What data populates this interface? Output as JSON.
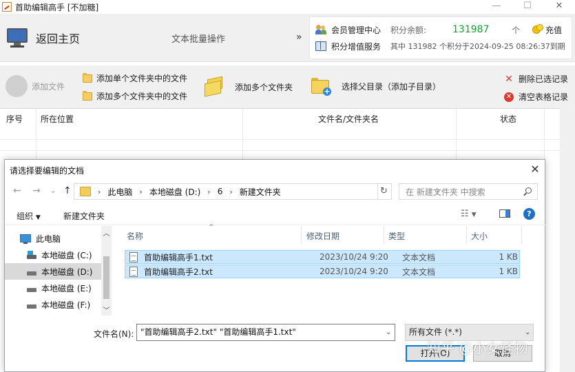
{
  "window": {
    "title": "首助编辑高手 [不加糖]",
    "minimize": "—",
    "maximize": "☐",
    "close": "✕"
  },
  "header": {
    "home_label": "返回主页",
    "batch_label": "文本批量操作",
    "arrow": "»",
    "member_center": "会员管理中心",
    "points_balance_label": "积分余额:",
    "points_balance": "131987",
    "points_unit": "个",
    "recharge": "充值",
    "points_service": "积分增值服务",
    "points_detail": "其中 131982 个积分于2024-09-25 08:26:37到期"
  },
  "toolbar": {
    "add_file": "添加文件",
    "add_single_folder": "添加单个文件夹中的文件",
    "add_multi_folder": "添加多个文件夹中的文件",
    "add_folders": "添加多个文件夹",
    "select_parent": "选择父目录（添加子目录）",
    "delete_selected": "删除已选记录",
    "clear_table": "清空表格记录"
  },
  "table": {
    "columns": [
      "序号",
      "所在位置",
      "文件名/文件夹名",
      "状态"
    ]
  },
  "dialog": {
    "title": "请选择要编辑的文档",
    "close": "✕",
    "breadcrumb": [
      "此电脑",
      "本地磁盘 (D:)",
      "6",
      "新建文件夹"
    ],
    "search_placeholder": "在 新建文件夹 中搜索",
    "organize": "组织",
    "new_folder": "新建文件夹",
    "help": "?",
    "nav_items": [
      {
        "label": "此电脑",
        "icon": "computer-icon"
      },
      {
        "label": "本地磁盘 (C:)",
        "icon": "drive-icon"
      },
      {
        "label": "本地磁盘 (D:)",
        "icon": "drive-icon"
      },
      {
        "label": "本地磁盘 (E:)",
        "icon": "drive-icon"
      },
      {
        "label": "本地磁盘 (F:)",
        "icon": "drive-icon"
      }
    ],
    "file_headers": [
      "名称",
      "修改日期",
      "类型",
      "大小"
    ],
    "files": [
      {
        "name": "首助编辑高手1.txt",
        "date": "2023/10/24 9:20",
        "type": "文本文档",
        "size": "1 KB"
      },
      {
        "name": "首助编辑高手2.txt",
        "date": "2023/10/24 9:20",
        "type": "文本文档",
        "size": "1 KB"
      }
    ],
    "filename_label": "文件名(N):",
    "filename_value": "\"首助编辑高手2.txt\" \"首助编辑高手1.txt\"",
    "filetype": "所有文件 (*.*)",
    "open": "打开(O)",
    "cancel": "取消"
  },
  "watermark": "知乎 @小女怪物",
  "colors": {
    "points_green": "#1a9b2f",
    "selection_bg": "#cce8ff",
    "selection_border": "#99d1ff",
    "accent_blue": "#0078d7"
  }
}
